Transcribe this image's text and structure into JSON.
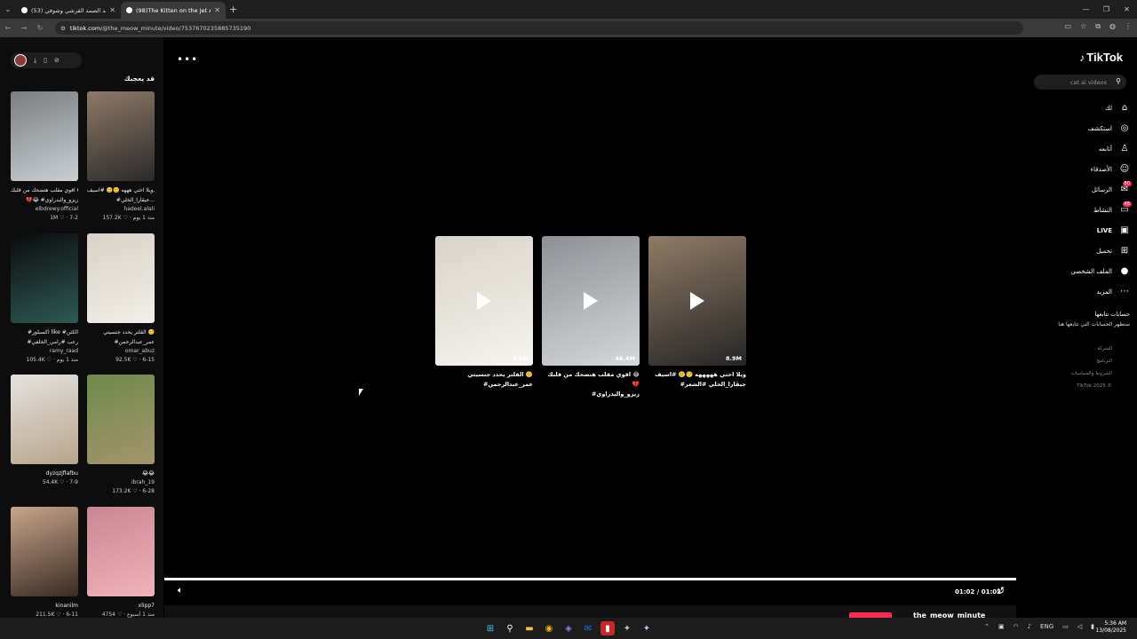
{
  "browser": {
    "tabs": [
      {
        "title": "(53) عبد الصمد القرشي وشوقي",
        "active": false
      },
      {
        "title": "(98)The Kitten on the Jet Adven",
        "active": true
      }
    ],
    "url_domain": "tiktok.com",
    "url_path": "/@the_meow_minute/video/7537670235885735190"
  },
  "left_panel": {
    "heading": "قد يعجبك",
    "cards": [
      {
        "desc": "ويلا اختي هههه 🙂🙂 #اسيف...",
        "desc2": "#جيڤارا_الخلي...",
        "user": "hadeel.alali",
        "stats": "157.2K ♡ · منذ 1 يوم",
        "colors": [
          "#8e7a66",
          "#2a2a2a"
        ]
      },
      {
        "desc": "اقوي مقلب هتضحك من قلبك 🙂🙂",
        "desc2": "💔😂 #زيزو_والبدراوي",
        "user": "elbdrewy.official",
        "stats": "1M ♡ · 7-2",
        "colors": [
          "#7a7d80",
          "#c9d0d4"
        ]
      },
      {
        "desc": "القلتر يحدد جنسيتي 🙂",
        "desc2": "#عمر_عبدالرحمن",
        "user": "omar_abuz",
        "stats": "92.5K ♡ · 6-15",
        "colors": [
          "#d8d2c6",
          "#f2efe8"
        ]
      },
      {
        "desc": "#اكسبلور like #الكتن",
        "desc2": "#رعب #رامي_الخلفي",
        "user": "ramy_raad",
        "stats": "105.4K ♡ · منذ 1 يوم",
        "colors": [
          "#0b0b0b",
          "#2e5a55"
        ]
      },
      {
        "desc": "😂😂",
        "desc2": "",
        "user": "ibrah_19",
        "stats": "173.2K ♡ · 6-28",
        "colors": [
          "#6d8a4a",
          "#a4956c"
        ]
      },
      {
        "desc": "dyzqzjflafbu",
        "desc2": "",
        "user": "",
        "stats": "54.4K ♡ · 7-9",
        "colors": [
          "#e4e2df",
          "#b7a58c"
        ]
      },
      {
        "desc": "xlipp7",
        "desc2": "",
        "user": "",
        "stats": "4754 ♡ · منذ 1 أسبوع",
        "colors": [
          "#c98692",
          "#f0b2bb"
        ]
      },
      {
        "desc": "kinanilm",
        "desc2": "",
        "user": "",
        "stats": "211.5K ♡ · 6-11",
        "colors": [
          "#c7a68a",
          "#3a2b24"
        ]
      }
    ]
  },
  "suggestions": [
    {
      "views": "3.6M",
      "title": "القلتر يحدد جنسيتي 🙂",
      "title2": "#عمر_عبدالرحمن",
      "colors": [
        "#d9d4c9",
        "#f5f3ee"
      ]
    },
    {
      "views": "46.4M",
      "title": "اقوي مقلب هتضحك من قلبك 😂💔",
      "title2": "#زيزو_والبدراوي",
      "colors": [
        "#8d9094",
        "#d4d8db"
      ]
    },
    {
      "views": "8.9M",
      "title": "ويلا اختي هههههه 🙂🙂 #اسيف",
      "title2": "#جيڤارا_الخلي #الشعر",
      "colors": [
        "#8f7b66",
        "#252525"
      ]
    }
  ],
  "sidebar": {
    "logo": "TikTok",
    "search_placeholder": "cat ai videos",
    "nav": [
      {
        "label": "لك",
        "icon": "home-icon",
        "glyph": "⌂"
      },
      {
        "label": "استكشف",
        "icon": "compass-icon",
        "glyph": "◎"
      },
      {
        "label": "أتابعه",
        "icon": "following-icon",
        "glyph": "♙"
      },
      {
        "label": "الأصدقاء",
        "icon": "friends-icon",
        "glyph": "☺"
      },
      {
        "label": "الرسائل",
        "icon": "inbox-icon",
        "glyph": "✉",
        "badge": "50"
      },
      {
        "label": "النشاط",
        "icon": "activity-icon",
        "glyph": "▭",
        "badge": "48"
      },
      {
        "label": "LIVE",
        "icon": "live-icon",
        "glyph": "▣"
      },
      {
        "label": "تحميل",
        "icon": "upload-icon",
        "glyph": "⊞"
      },
      {
        "label": "الملف الشخصي",
        "icon": "profile-icon",
        "glyph": "●"
      },
      {
        "label": "المزيد",
        "icon": "more-icon",
        "glyph": "⋯"
      }
    ],
    "follow_title": "حسابات تتابعها",
    "follow_sub": "ستظهر الحسابات التي تتابعها هنا",
    "footer": [
      "الشركة",
      "البرنامج",
      "الشروط والسياسات",
      "TikTok 2025 ©"
    ]
  },
  "player": {
    "time": "01:02 / 01:02",
    "bottom_user": "the_meow_minute"
  },
  "taskbar": {
    "lang": "ENG",
    "time": "5:36 AM",
    "date": "13/08/2025"
  }
}
